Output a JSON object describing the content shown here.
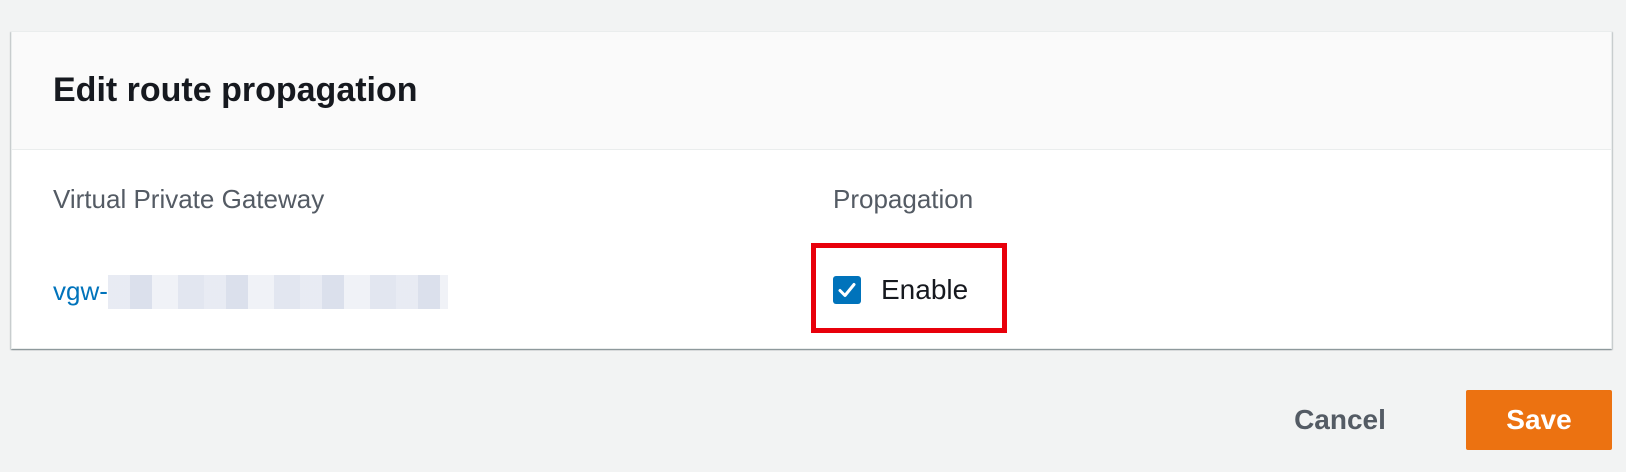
{
  "panel": {
    "title": "Edit route propagation"
  },
  "table": {
    "columns": [
      "Virtual Private Gateway",
      "Propagation"
    ],
    "rows": [
      {
        "gateway": "vgw-",
        "propagation_checked": true,
        "propagation_label": "Enable"
      }
    ]
  },
  "actions": {
    "cancel_label": "Cancel",
    "save_label": "Save"
  },
  "colors": {
    "primary_button": "#ec7211",
    "link": "#0073bb",
    "checkbox": "#0073bb",
    "highlight": "#e8000b"
  },
  "icons": {
    "checkbox": "checkmark-icon"
  }
}
